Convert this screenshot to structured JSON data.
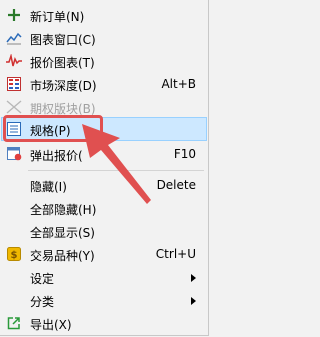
{
  "menu": {
    "items": [
      {
        "label": "新订单(N)",
        "accel": "",
        "icon": "new-order-icon",
        "disabled": false
      },
      {
        "label": "图表窗口(C)",
        "accel": "",
        "icon": "chart-window-icon",
        "disabled": false
      },
      {
        "label": "报价图表(T)",
        "accel": "",
        "icon": "quote-chart-icon",
        "disabled": false
      },
      {
        "label": "市场深度(D)",
        "accel": "Alt+B",
        "icon": "market-depth-icon",
        "disabled": false
      },
      {
        "label": "期权版块(B)",
        "accel": "",
        "icon": "options-board-icon",
        "disabled": true
      },
      {
        "label": "规格(P)",
        "accel": "",
        "icon": "specification-icon",
        "disabled": false,
        "selected": true
      },
      {
        "label": "弹出报价(",
        "accel": "F10",
        "icon": "popup-quote-icon",
        "disabled": false
      },
      {
        "label": "隐藏(I)",
        "accel": "Delete",
        "icon": "",
        "disabled": false
      },
      {
        "label": "全部隐藏(H)",
        "accel": "",
        "icon": "",
        "disabled": false
      },
      {
        "label": "全部显示(S)",
        "accel": "",
        "icon": "",
        "disabled": false
      },
      {
        "label": "交易品种(Y)",
        "accel": "Ctrl+U",
        "icon": "symbols-icon",
        "disabled": false
      },
      {
        "label": "设定",
        "accel": "",
        "icon": "",
        "disabled": false,
        "submenu": true
      },
      {
        "label": "分类",
        "accel": "",
        "icon": "",
        "disabled": false,
        "submenu": true
      },
      {
        "label": "导出(X)",
        "accel": "",
        "icon": "export-icon",
        "disabled": false
      }
    ]
  },
  "colors": {
    "highlight_bg": "#cde8ff",
    "highlight_border": "#99d1ff",
    "callout": "#e05050"
  }
}
